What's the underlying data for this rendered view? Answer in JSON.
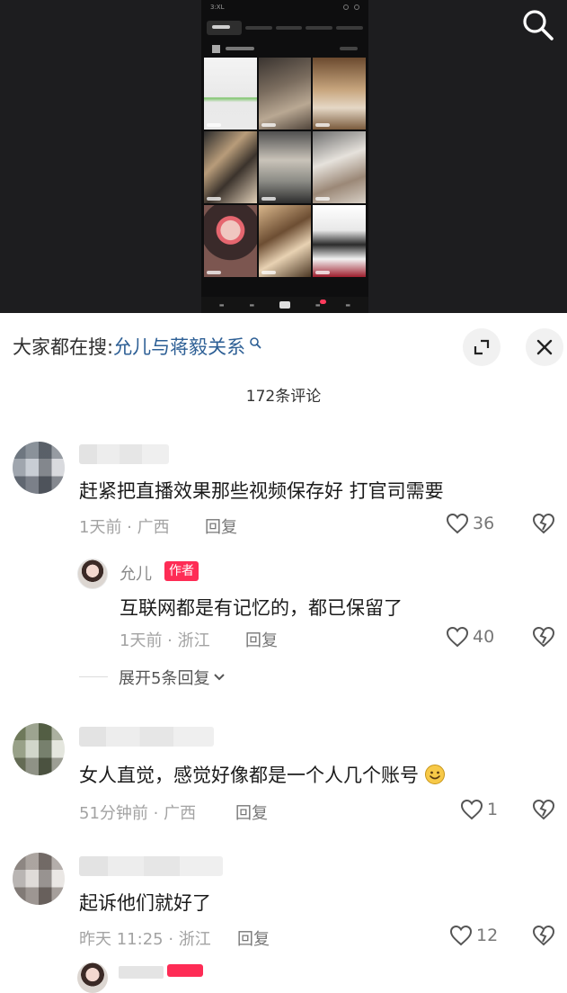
{
  "video": {
    "phone_time": "3:XL"
  },
  "hot_search": {
    "prefix": "大家都在搜:",
    "term": "允儿与蒋毅关系"
  },
  "comment_count": "172条评论",
  "comments": [
    {
      "text": "赶紧把直播效果那些视频保存好 打官司需要",
      "time": "1天前 · 广西",
      "reply_label": "回复",
      "likes": "36",
      "replies": [
        {
          "name": "允儿",
          "badge": "作者",
          "text": "互联网都是有记忆的，都已保留了",
          "time": "1天前 · 浙江",
          "reply_label": "回复",
          "likes": "40"
        }
      ],
      "expand_label": "展开5条回复"
    },
    {
      "text": "女人直觉，感觉好像都是一个人几个账号",
      "time": "51分钟前 · 广西",
      "reply_label": "回复",
      "likes": "1"
    },
    {
      "text": "起诉他们就好了",
      "time": "昨天 11:25 · 浙江",
      "reply_label": "回复",
      "likes": "12"
    }
  ],
  "icons": {
    "search": "search-icon",
    "expand": "expand-icon",
    "close": "close-icon",
    "like": "heart-icon",
    "dislike": "broken-heart-icon",
    "emoji": "smile-emoji-icon",
    "chevron": "chevron-down-icon"
  },
  "colors": {
    "link": "#2d5f95",
    "author_badge": "#fe2c55",
    "meta": "#a3a3a3"
  }
}
